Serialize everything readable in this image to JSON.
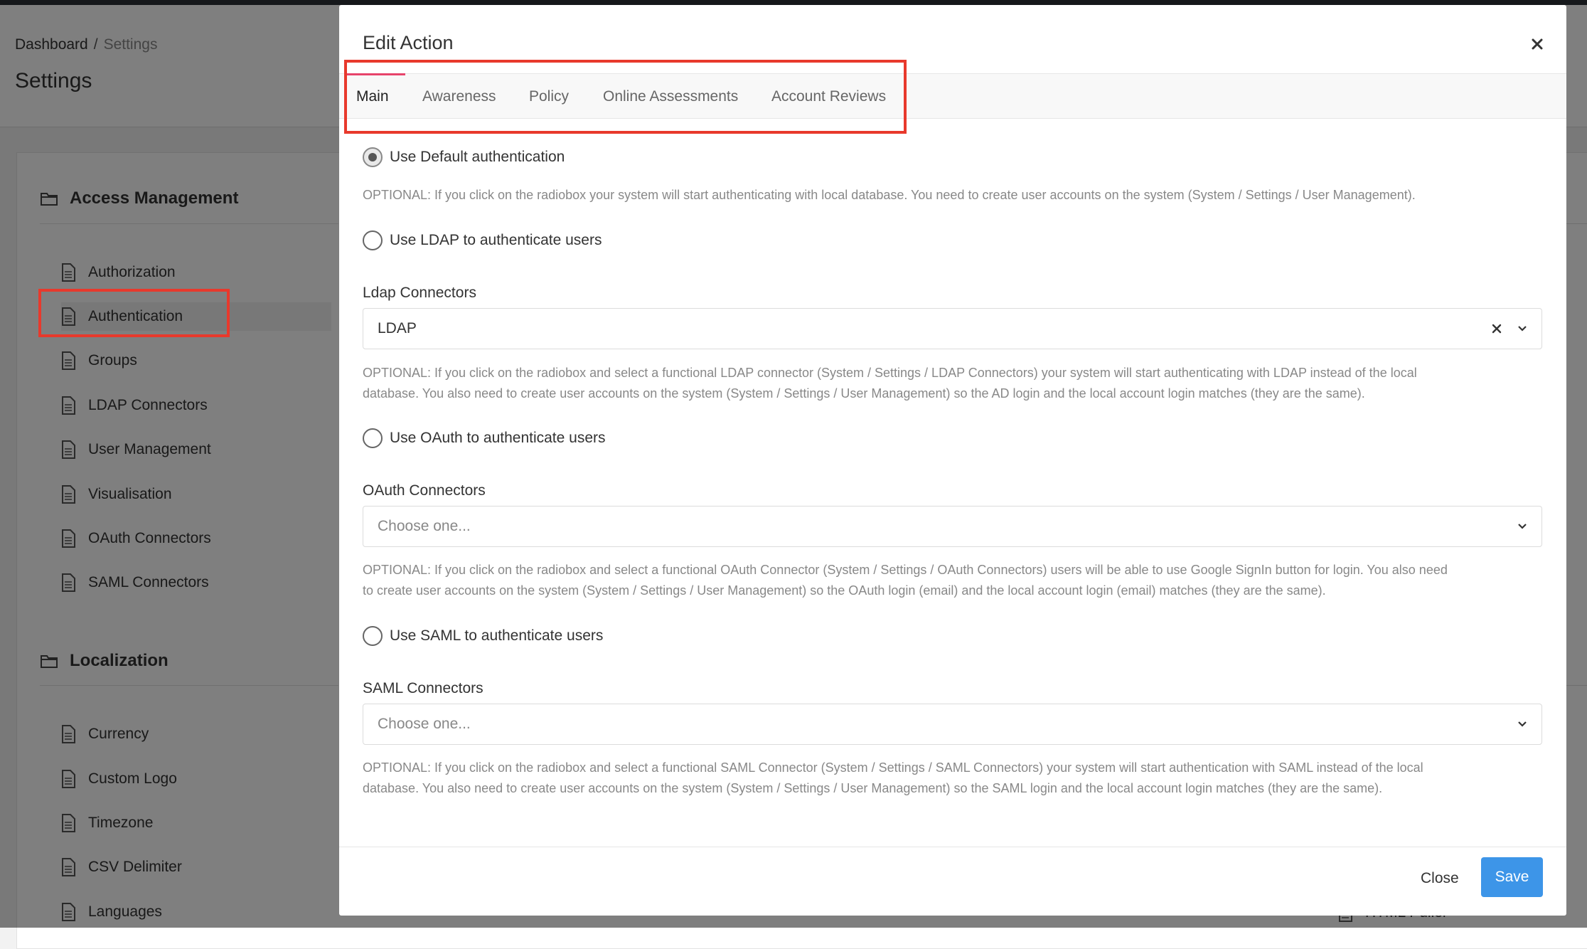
{
  "background": {
    "breadcrumb": {
      "root": "Dashboard",
      "separator": "/",
      "current": "Settings"
    },
    "page_title": "Settings",
    "sections": [
      {
        "title": "Access Management",
        "items": [
          "Authorization",
          "Authentication",
          "Groups",
          "LDAP Connectors",
          "User Management",
          "Visualisation",
          "OAuth Connectors",
          "SAML Connectors"
        ]
      },
      {
        "title": "Localization",
        "items": [
          "Currency",
          "Custom Logo",
          "Timezone",
          "CSV Delimiter",
          "Languages"
        ]
      }
    ],
    "highlighted_item": "Authentication",
    "partial_right_item": "HTML Puller"
  },
  "modal": {
    "title": "Edit Action",
    "tabs": [
      "Main",
      "Awareness",
      "Policy",
      "Online Assessments",
      "Account Reviews"
    ],
    "active_tab": "Main",
    "options": [
      {
        "label": "Use Default authentication",
        "checked": true,
        "help": "OPTIONAL: If you click on the radiobox your system will start authenticating with local database. You need to create user accounts on the system (System / Settings / User Management)."
      },
      {
        "label": "Use LDAP to authenticate users",
        "checked": false,
        "connector_label": "Ldap Connectors",
        "select_value": "LDAP",
        "help_line1": "OPTIONAL: If you click on the radiobox and select a functional LDAP connector (System / Settings / LDAP Connectors) your system will start authenticating with LDAP instead of the local",
        "help_line2": "database. You also need to create user accounts on the system (System / Settings / User Management) so the AD login and the local account login matches (they are the same)."
      },
      {
        "label": "Use OAuth to authenticate users",
        "checked": false,
        "connector_label": "OAuth Connectors",
        "select_placeholder": "Choose one...",
        "help_line1": "OPTIONAL: If you click on the radiobox and select a functional OAuth Connector (System / Settings / OAuth Connectors) users will be able to use Google SignIn button for login. You also need",
        "help_line2": "to create user accounts on the system (System / Settings / User Management) so the OAuth login (email) and the local account login (email) matches (they are the same)."
      },
      {
        "label": "Use SAML to authenticate users",
        "checked": false,
        "connector_label": "SAML Connectors",
        "select_placeholder": "Choose one...",
        "help_line1": "OPTIONAL: If you click on the radiobox and select a functional SAML Connector (System / Settings / SAML Connectors) your system will start authentication with SAML instead of the local",
        "help_line2": "database. You also need to create user accounts on the system (System / Settings / User Management) so the SAML login and the local account login matches (they are the same)."
      }
    ],
    "footer": {
      "close_label": "Close",
      "save_label": "Save"
    }
  },
  "colors": {
    "accent": "#3d95e8",
    "tab_active_underline": "#e7446b",
    "annotation": "#e8392c"
  },
  "icons": [
    "folder-icon",
    "document-icon",
    "close-icon",
    "chevron-down-icon",
    "clear-icon"
  ]
}
